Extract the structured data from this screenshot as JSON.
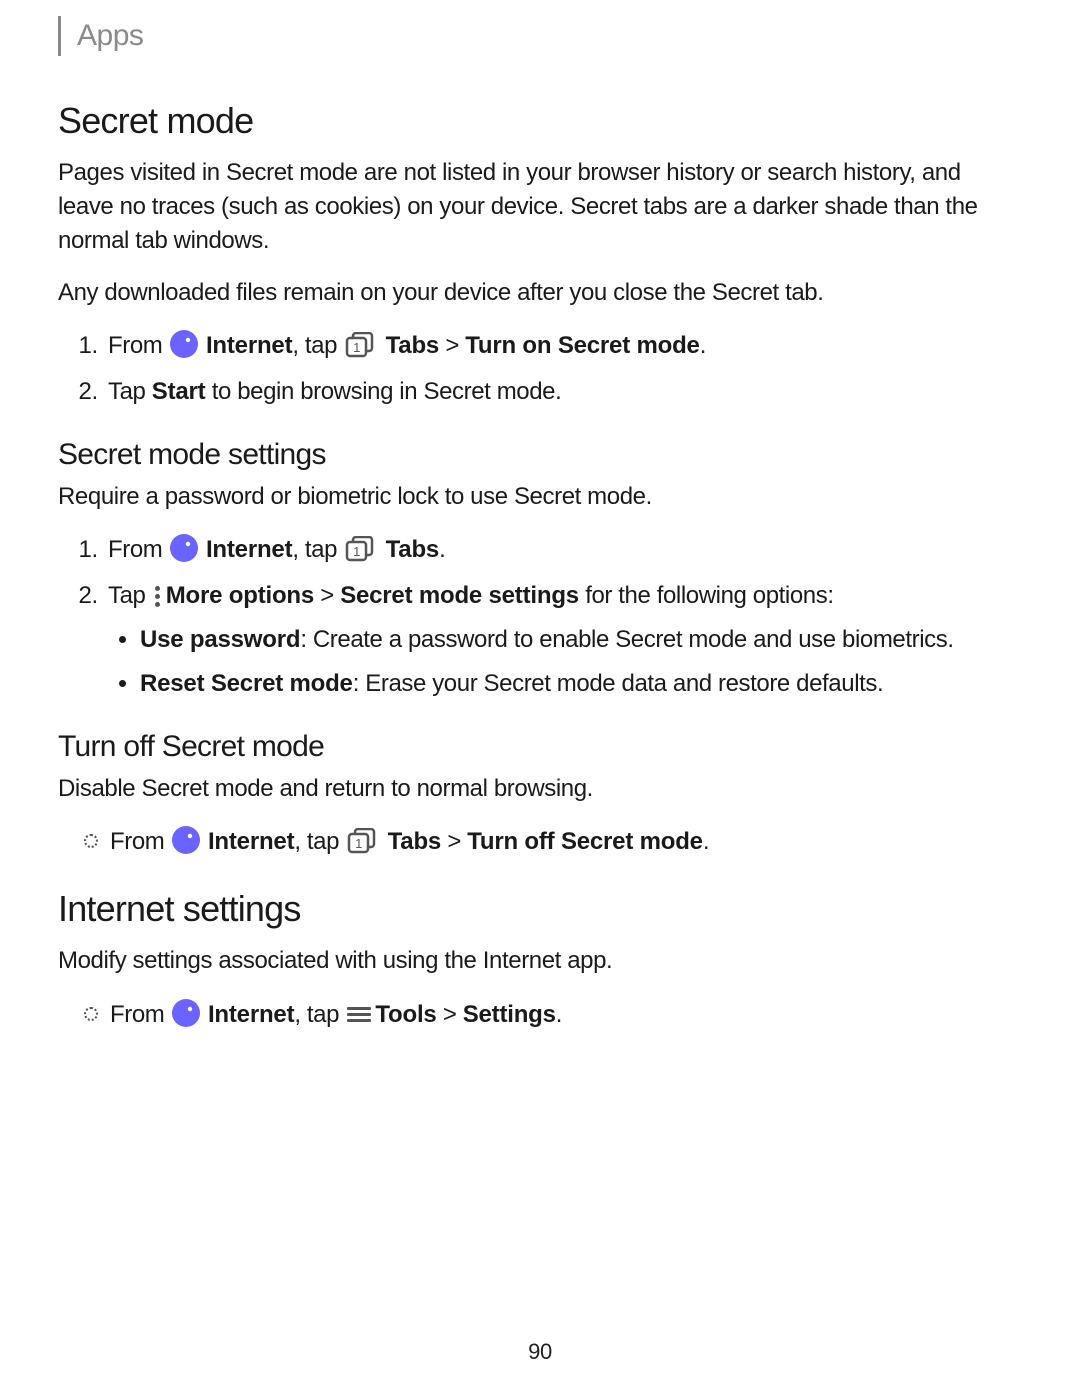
{
  "breadcrumb": "Apps",
  "page_number": "90",
  "sec1": {
    "title": "Secret mode",
    "p1": "Pages visited in Secret mode are not listed in your browser history or search history, and leave no traces (such as cookies) on your device. Secret tabs are a darker shade than the normal tab windows.",
    "p2": "Any downloaded files remain on your device after you close the Secret tab.",
    "step1_a": "From ",
    "step1_b": "Internet",
    "step1_c": ", tap ",
    "step1_d": "Tabs",
    "step1_e": " > ",
    "step1_f": "Turn on Secret mode",
    "step1_g": ".",
    "step2_a": "Tap ",
    "step2_b": "Start",
    "step2_c": " to begin browsing in Secret mode."
  },
  "sec2": {
    "title": "Secret mode settings",
    "p1": "Require a password or biometric lock to use Secret mode.",
    "step1_a": "From ",
    "step1_b": "Internet",
    "step1_c": ", tap ",
    "step1_d": "Tabs",
    "step1_e": ".",
    "step2_a": "Tap ",
    "step2_b": "More options",
    "step2_c": " > ",
    "step2_d": "Secret mode settings",
    "step2_e": " for the following options:",
    "opt1_a": "Use password",
    "opt1_b": ": Create a password to enable Secret mode and use biometrics.",
    "opt2_a": "Reset Secret mode",
    "opt2_b": ": Erase your Secret mode data and restore defaults."
  },
  "sec3": {
    "title": "Turn off Secret mode",
    "p1": "Disable Secret mode and return to normal browsing.",
    "step1_a": "From ",
    "step1_b": "Internet",
    "step1_c": ", tap ",
    "step1_d": "Tabs",
    "step1_e": " > ",
    "step1_f": "Turn off Secret mode",
    "step1_g": "."
  },
  "sec4": {
    "title": "Internet settings",
    "p1": "Modify settings associated with using the Internet app.",
    "step1_a": "From ",
    "step1_b": "Internet",
    "step1_c": ", tap ",
    "step1_d": "Tools",
    "step1_e": " > ",
    "step1_f": "Settings",
    "step1_g": "."
  }
}
